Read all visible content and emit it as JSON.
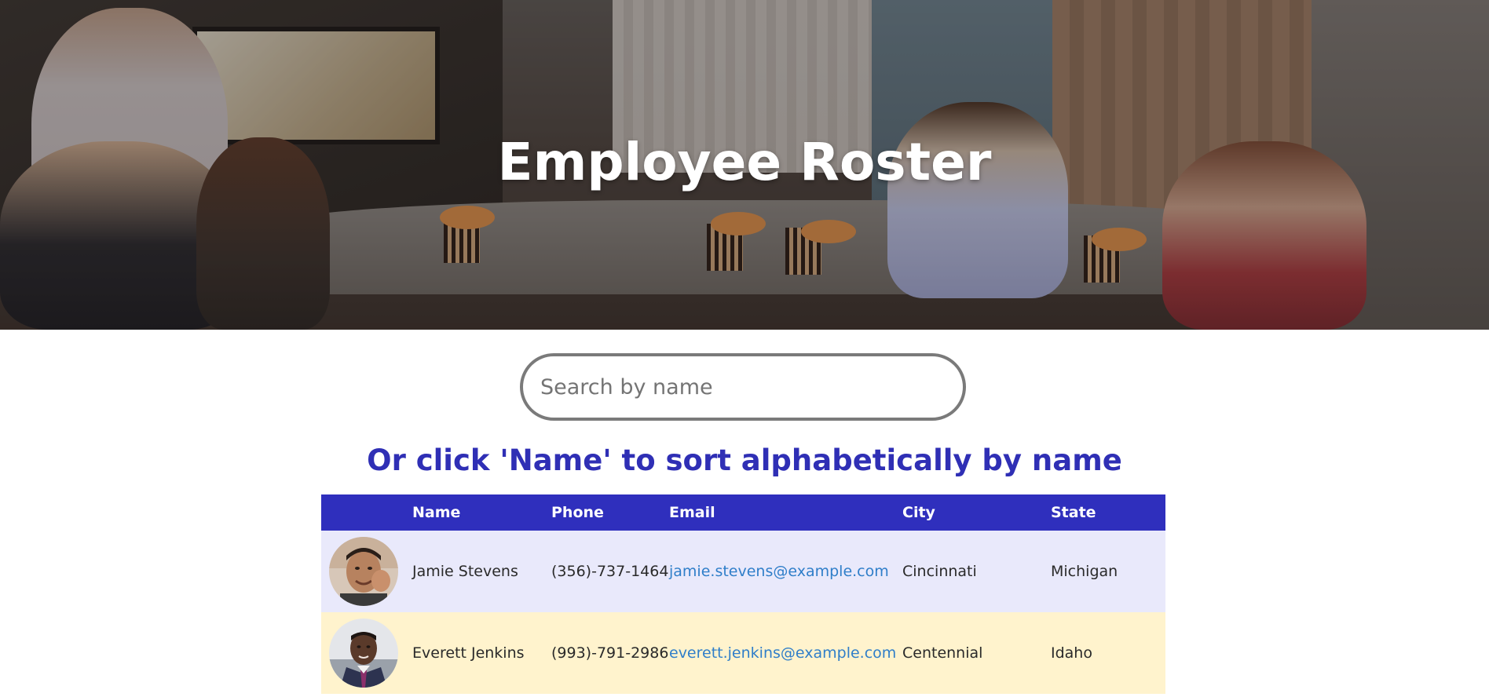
{
  "hero": {
    "title": "Employee Roster"
  },
  "search": {
    "placeholder": "Search by name",
    "value": ""
  },
  "instruction": "Or click 'Name' to sort alphabetically by name",
  "table": {
    "headers": {
      "name": "Name",
      "phone": "Phone",
      "email": "Email",
      "city": "City",
      "state": "State"
    },
    "rows": [
      {
        "name": "Jamie Stevens",
        "phone": "(356)-737-1464",
        "email": "jamie.stevens@example.com",
        "city": "Cincinnati",
        "state": "Michigan"
      },
      {
        "name": "Everett Jenkins",
        "phone": "(993)-791-2986",
        "email": "everett.jenkins@example.com",
        "city": "Centennial",
        "state": "Idaho"
      }
    ]
  },
  "colors": {
    "header_bg": "#2f2fbd",
    "instruction_text": "#2f2fb5",
    "row_odd_bg": "#e9e9fb",
    "row_even_bg": "#fff3cd",
    "link": "#2f7ec9"
  }
}
